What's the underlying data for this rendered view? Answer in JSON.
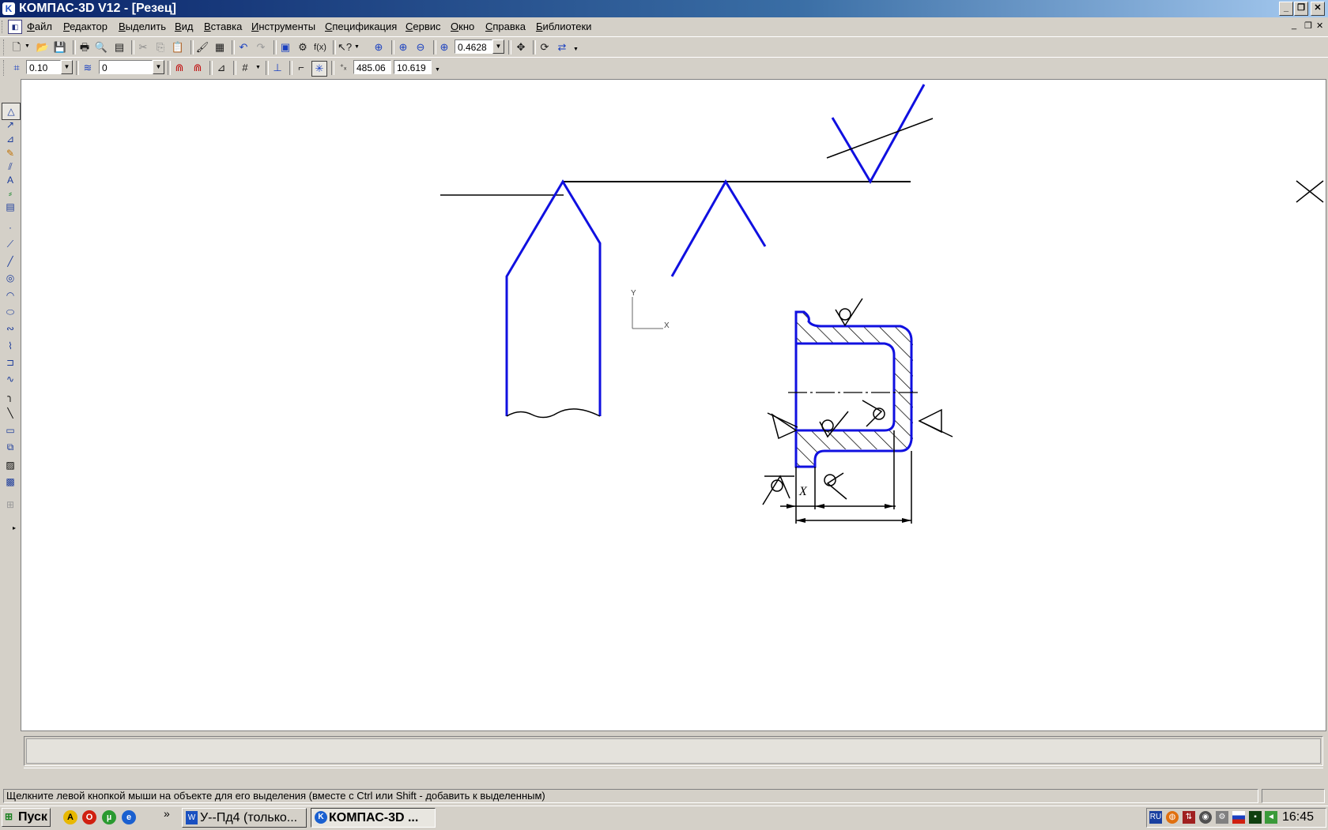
{
  "app": {
    "title": "КОМПАС-3D V12 - [Резец]",
    "title_icon": "kompas-logo-icon",
    "window_controls": [
      "minimize-icon",
      "restore-icon",
      "close-icon"
    ],
    "doc_controls": [
      "minimize-icon",
      "restore-icon",
      "close-icon"
    ]
  },
  "menu": {
    "items": [
      "Файл",
      "Редактор",
      "Выделить",
      "Вид",
      "Вставка",
      "Инструменты",
      "Спецификация",
      "Сервис",
      "Окно",
      "Справка",
      "Библиотеки"
    ]
  },
  "toolbar_standard": {
    "icons": [
      "new-icon",
      "open-icon",
      "save-icon",
      "print-icon",
      "print-preview-icon",
      "print-setup-icon",
      "cut-icon",
      "copy-icon",
      "paste-icon",
      "format-brush-icon",
      "properties-icon",
      "undo-icon",
      "redo-icon",
      "manager-icon",
      "library-icon",
      "variables-fx-icon",
      "help-pointer-icon",
      "zoom-window-icon",
      "zoom-in-icon",
      "zoom-out-icon",
      "zoom-scale-icon",
      "pan-icon",
      "refresh-icon",
      "redraw-icon"
    ],
    "zoom_value": "0.4628",
    "fx_label": "f(x)"
  },
  "toolbar_current_state": {
    "step_value": "0.10",
    "layer_value": "0",
    "coord_x": "485.06",
    "coord_y": "10.619",
    "icons": [
      "cursor-step-icon",
      "layers-icon",
      "snap-magnet-icon",
      "snap-local-icon",
      "ortho-icon",
      "grid-icon",
      "local-cs-icon",
      "ortho-mode-icon",
      "round-icon",
      "coordinates-icon"
    ]
  },
  "left_toolbar": {
    "icons": [
      "geometry-icon",
      "dimensions-icon",
      "designations-icon",
      "edit-icon",
      "parametrization-icon",
      "measure-icon",
      "select-icon",
      "spec-icon",
      "point-icon",
      "auxiliary-line-icon",
      "segment-icon",
      "circle-icon",
      "arc-icon",
      "ellipse-icon",
      "spline-icon",
      "polyline-icon",
      "equidistant-icon",
      "bezier-icon",
      "fillet-icon",
      "chamfer-icon",
      "rectangle-icon",
      "contour-icon",
      "hatch-icon",
      "fill-icon",
      "macro-icon"
    ]
  },
  "drawing": {
    "axis_labels": {
      "y": "Y",
      "x": "X"
    },
    "dimension_label": "X",
    "line_color": "#1010e0",
    "thin_color": "#000000"
  },
  "status": {
    "hint": "Щелкните левой кнопкой мыши на объекте для его выделения (вместе с Ctrl или Shift - добавить к выделенным)"
  },
  "taskbar": {
    "start_label": "Пуск",
    "quicklaunch": [
      "avast-icon",
      "opera-icon",
      "utorrent-icon",
      "ie-icon"
    ],
    "overflow": "»",
    "buttons": [
      {
        "label": "У--Пд4 (только...",
        "icon": "word-icon",
        "active": false
      },
      {
        "label": "КОМПАС-3D ...",
        "icon": "kompas-icon",
        "active": true
      }
    ],
    "tray": [
      "lang-ru-icon",
      "antivirus-icon",
      "network-icon",
      "media-icon",
      "update-icon",
      "flag-icon",
      "nvidia-icon",
      "volume-icon"
    ],
    "lang": "RU",
    "clock": "16:45"
  }
}
